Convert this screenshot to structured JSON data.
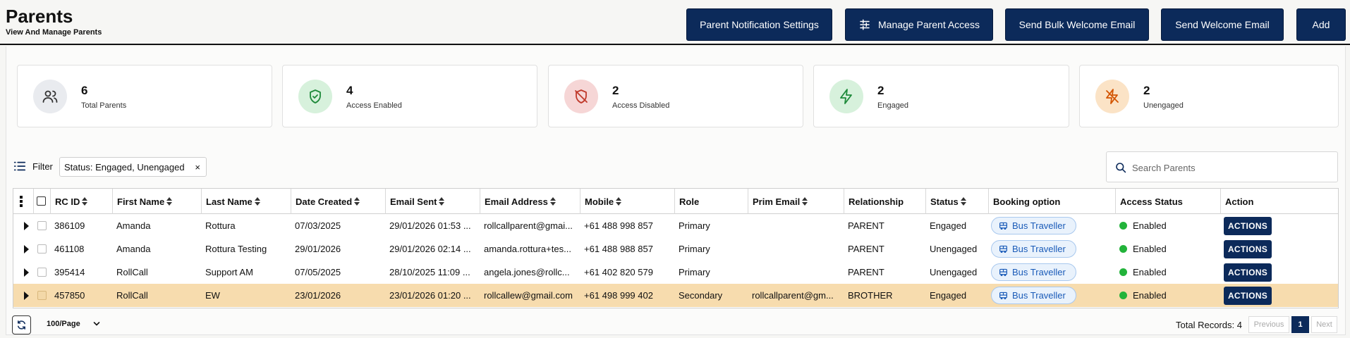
{
  "header": {
    "title": "Parents",
    "subtitle": "View And Manage Parents",
    "buttons": {
      "notification_settings": "Parent Notification Settings",
      "manage_access": "Manage Parent Access",
      "bulk_welcome": "Send Bulk Welcome Email",
      "welcome": "Send Welcome Email",
      "add": "Add"
    }
  },
  "stats": [
    {
      "value": "6",
      "label": "Total Parents",
      "icon": "users-icon",
      "bg": "#e9ebef",
      "color": "#333333"
    },
    {
      "value": "4",
      "label": "Access Enabled",
      "icon": "shield-check-icon",
      "bg": "#d7f1dc",
      "color": "#1e8a3a"
    },
    {
      "value": "2",
      "label": "Access Disabled",
      "icon": "shield-off-icon",
      "bg": "#f6d6d6",
      "color": "#c0392b"
    },
    {
      "value": "2",
      "label": "Engaged",
      "icon": "zap-icon",
      "bg": "#d7f1dc",
      "color": "#1e8a3a"
    },
    {
      "value": "2",
      "label": "Unengaged",
      "icon": "zap-off-icon",
      "bg": "#fbe3c6",
      "color": "#d35400"
    }
  ],
  "filter": {
    "label": "Filter",
    "chip": "Status: Engaged, Unengaged",
    "chip_close": "×"
  },
  "search": {
    "placeholder": "Search Parents"
  },
  "table": {
    "columns": {
      "rc_id": "RC ID",
      "first_name": "First Name",
      "last_name": "Last Name",
      "date_created": "Date Created",
      "email_sent": "Email Sent",
      "email_address": "Email Address",
      "mobile": "Mobile",
      "role": "Role",
      "prim_email": "Prim Email",
      "relationship": "Relationship",
      "status": "Status",
      "booking_option": "Booking option",
      "access_status": "Access Status",
      "action": "Action"
    },
    "rows": [
      {
        "rc_id": "386109",
        "first_name": "Amanda",
        "last_name": "Rottura",
        "date_created": "07/03/2025",
        "email_sent": "29/01/2026 01:53 ...",
        "email_address": "rollcallparent@gmai...",
        "mobile": "+61 488 998 857",
        "role": "Primary",
        "prim_email": "",
        "relationship": "PARENT",
        "status": "Engaged",
        "booking_option": "Bus Traveller",
        "access_status": "Enabled",
        "action": "ACTIONS"
      },
      {
        "rc_id": "461108",
        "first_name": "Amanda",
        "last_name": "Rottura Testing",
        "date_created": "29/01/2026",
        "email_sent": "29/01/2026 02:14 ...",
        "email_address": "amanda.rottura+tes...",
        "mobile": "+61 488 988 857",
        "role": "Primary",
        "prim_email": "",
        "relationship": "PARENT",
        "status": "Unengaged",
        "booking_option": "Bus Traveller",
        "access_status": "Enabled",
        "action": "ACTIONS"
      },
      {
        "rc_id": "395414",
        "first_name": "RollCall",
        "last_name": "Support AM",
        "date_created": "07/05/2025",
        "email_sent": "28/10/2025 11:09 ...",
        "email_address": "angela.jones@rollc...",
        "mobile": "+61 402 820 579",
        "role": "Primary",
        "prim_email": "",
        "relationship": "PARENT",
        "status": "Unengaged",
        "booking_option": "Bus Traveller",
        "access_status": "Enabled",
        "action": "ACTIONS"
      },
      {
        "rc_id": "457850",
        "first_name": "RollCall",
        "last_name": "EW",
        "date_created": "23/01/2026",
        "email_sent": "23/01/2026 01:20 ...",
        "email_address": "rollcallew@gmail.com",
        "mobile": "+61 498 999 402",
        "role": "Secondary",
        "prim_email": "rollcallparent@gm...",
        "relationship": "BROTHER",
        "status": "Engaged",
        "booking_option": "Bus Traveller",
        "access_status": "Enabled",
        "action": "ACTIONS"
      }
    ]
  },
  "footer": {
    "page_size": "100/Page",
    "total_records": "Total Records: 4",
    "prev": "Previous",
    "page": "1",
    "next": "Next"
  },
  "colors": {
    "primary": "#0c2a5a",
    "highlight_row": "#f7dcae",
    "enabled": "#22b33a",
    "pill_text": "#1a5bb8"
  }
}
